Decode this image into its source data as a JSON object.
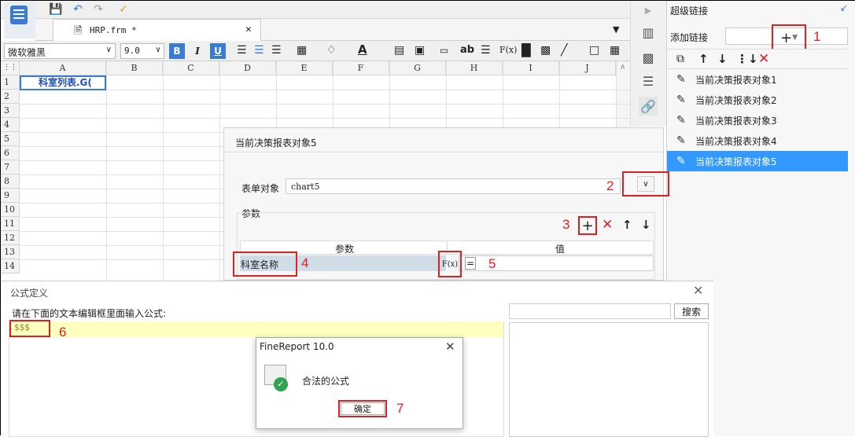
{
  "editor": {
    "tab_label": "HRP.frm *",
    "font_name": "微软雅黑",
    "font_size": "9.0",
    "columns": [
      "A",
      "B",
      "C",
      "D",
      "E",
      "F",
      "G",
      "H",
      "I",
      "J"
    ],
    "rows": [
      "1",
      "2",
      "3",
      "4",
      "5",
      "6",
      "7",
      "8",
      "9",
      "10",
      "11",
      "12",
      "13",
      "14"
    ],
    "cell_a1": "科室列表.G(",
    "format_buttons": [
      "B",
      "I",
      "U"
    ]
  },
  "hyperlink_panel": {
    "title": "超级链接",
    "add_label": "添加链接",
    "items": [
      "当前决策报表对象1",
      "当前决策报表对象2",
      "当前决策报表对象3",
      "当前决策报表对象4",
      "当前决策报表对象5"
    ],
    "selected_index": 4
  },
  "link_dialog": {
    "title": "当前决策报表对象5",
    "form_object_label": "表单对象",
    "form_object_value": "chart5",
    "params_label": "参数",
    "col_param": "参数",
    "col_value": "值",
    "param_name": "科室名称",
    "param_value": "=",
    "fx_label": "F(x)"
  },
  "formula_dialog": {
    "title": "公式定义",
    "instruction": "请在下面的文本编辑框里面输入公式:",
    "formula_text": "$$$",
    "search_button": "搜索"
  },
  "message_box": {
    "title": "FineReport 10.0",
    "message": "合法的公式",
    "ok_button": "确定"
  },
  "annotations": [
    "1",
    "2",
    "3",
    "4",
    "5",
    "6",
    "7"
  ],
  "colors": {
    "selection": "#3399ff",
    "accent_red": "#e02020",
    "formula_highlight": "#ffffc0"
  }
}
